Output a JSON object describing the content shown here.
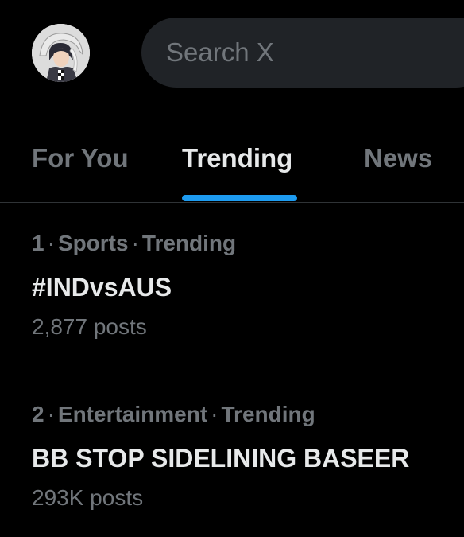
{
  "header": {
    "avatar_icon": "user-avatar",
    "search": {
      "placeholder": "Search X"
    }
  },
  "tabs": [
    {
      "label": "For You",
      "active": false
    },
    {
      "label": "Trending",
      "active": true
    },
    {
      "label": "News",
      "active": false
    }
  ],
  "colors": {
    "background": "#000000",
    "accent": "#1d9bf0",
    "text_primary": "#e7e9ea",
    "text_secondary": "#71767b",
    "search_background": "#202327",
    "divider": "#2f3336"
  },
  "trends": [
    {
      "rank": "1",
      "category": "Sports",
      "status": "Trending",
      "name": "#INDvsAUS",
      "posts": "2,877 posts"
    },
    {
      "rank": "2",
      "category": "Entertainment",
      "status": "Trending",
      "name": "BB STOP SIDELINING BASEER",
      "posts": "293K posts"
    }
  ]
}
